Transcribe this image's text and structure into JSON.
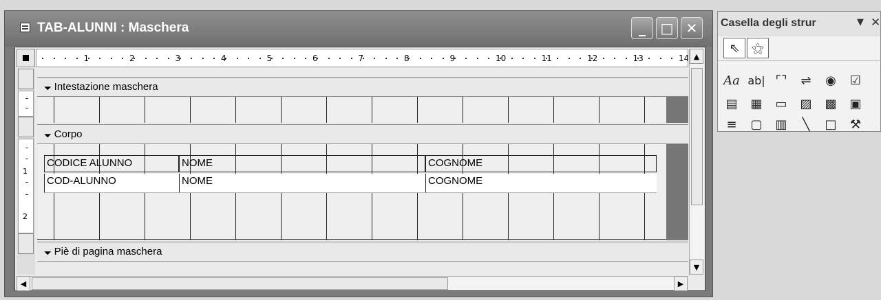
{
  "window": {
    "title": "TAB-ALUNNI : Maschera",
    "buttons": {
      "minimize": "_",
      "maximize": "□",
      "close": "✕"
    }
  },
  "ruler": {
    "numbers": [
      "1",
      "2",
      "3",
      "4",
      "5",
      "6",
      "7",
      "8",
      "9",
      "10",
      "11",
      "12",
      "13",
      "14"
    ],
    "vertical_numbers": [
      "1",
      "2"
    ]
  },
  "sections": {
    "header": "Intestazione maschera",
    "body": "Corpo",
    "footer": "Piè di pagina maschera"
  },
  "labels": {
    "codice": "CODICE ALUNNO",
    "nome": "NOME",
    "cognome": "COGNOME"
  },
  "fields": {
    "codice": "COD-ALUNNO",
    "nome": "NOME",
    "cognome": "COGNOME"
  },
  "scrollbar": {
    "up": "▲",
    "down": "▼",
    "left": "◀",
    "right": "▶"
  },
  "toolbox": {
    "title": "Casella degli strur",
    "menu": "▼",
    "close": "✕",
    "icons": {
      "select": "⇖",
      "wizard": "⚝",
      "label": "Aa",
      "textbox": "ab|",
      "group": "⌜⌝",
      "toggle": "⇌",
      "radio": "◉",
      "checkbox": "☑",
      "combo": "▤",
      "list": "▦",
      "button": "▭",
      "image": "▨",
      "unbound": "▩",
      "bound": "▣",
      "pagebreak": "≡",
      "tab": "▢",
      "subform": "▥",
      "line": "╲",
      "rect": "□",
      "more": "⚒"
    }
  },
  "colors": {
    "title_bg": "#7a7a7a",
    "surface": "#ebebeb",
    "grid_line": "#222222"
  }
}
